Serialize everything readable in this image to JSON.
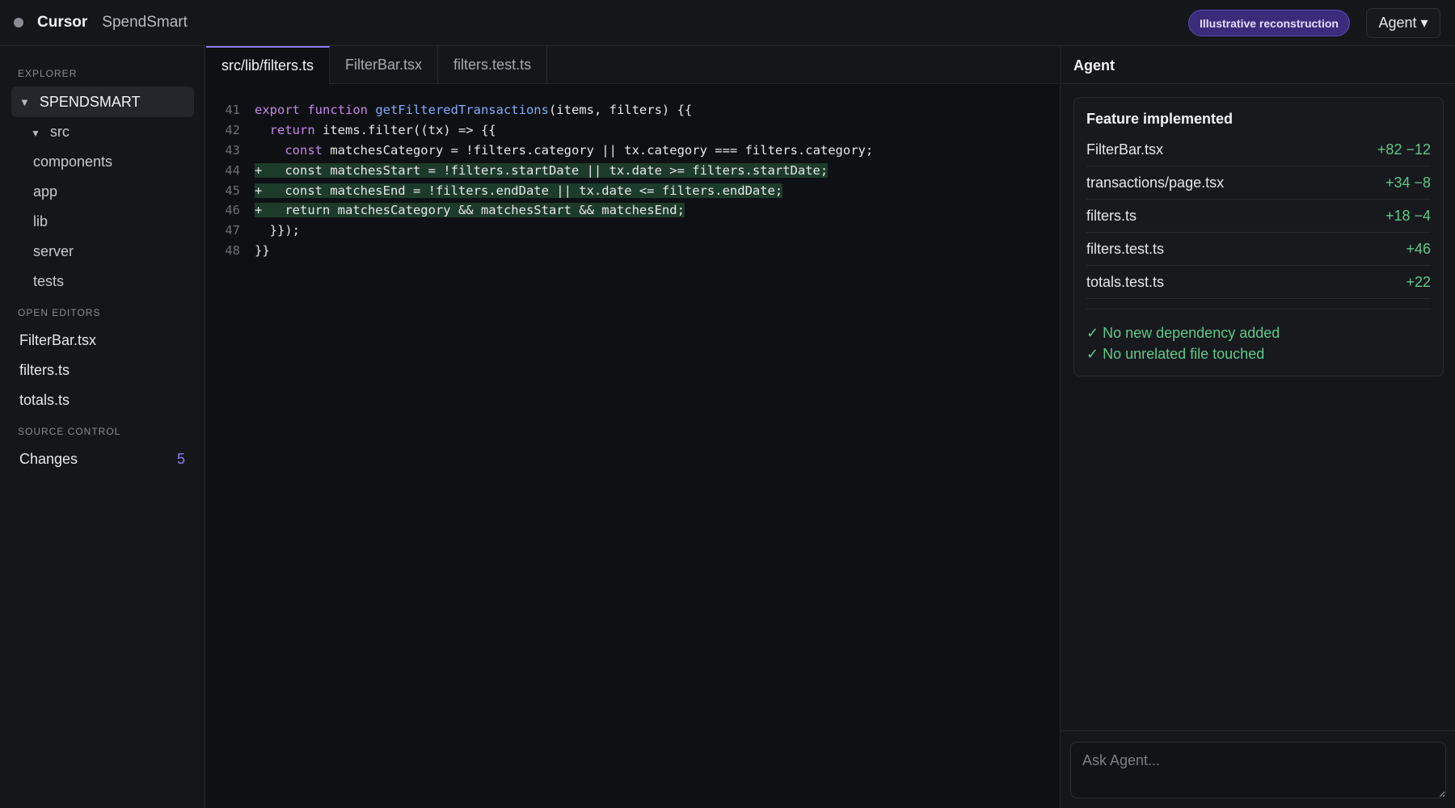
{
  "titlebar": {
    "app_name": "Cursor",
    "project_name": "SpendSmart",
    "badge": "Illustrative reconstruction",
    "agent_dropdown": "Agent ▾"
  },
  "sidebar": {
    "explorer_title": "EXPLORER",
    "root": "SPENDSMART",
    "tree": [
      "src",
      "components",
      "app",
      "lib",
      "server",
      "tests"
    ],
    "open_editors_title": "OPEN EDITORS",
    "open_editors": [
      "FilterBar.tsx",
      "filters.ts",
      "totals.ts"
    ],
    "source_control_title": "SOURCE CONTROL",
    "changes_label": "Changes",
    "changes_count": "5"
  },
  "editor": {
    "tabs": [
      "src/lib/filters.ts",
      "FilterBar.tsx",
      "filters.test.ts"
    ],
    "line_numbers": [
      "41",
      "42",
      "43",
      "44",
      "45",
      "46",
      "47",
      "48"
    ],
    "lines": [
      {
        "kw": "export function ",
        "fn": "getFilteredTransactions",
        "rest": "(items, filters) {{"
      },
      {
        "indent": "  ",
        "kw": "return ",
        "rest": "items.filter((tx) => {{"
      },
      {
        "indent": "    ",
        "kw": "const ",
        "rest": "matchesCategory = !filters.category || tx.category === filters.category;"
      },
      {
        "text": "+   const matchesStart = !filters.startDate || tx.date >= filters.startDate;"
      },
      {
        "text": "+   const matchesEnd = !filters.endDate || tx.date <= filters.endDate;"
      },
      {
        "text": "+   return matchesCategory && matchesStart && matchesEnd;"
      },
      {
        "text": "  }});"
      },
      {
        "text": "}}"
      }
    ]
  },
  "agent": {
    "title": "Agent",
    "card_title": "Feature implemented",
    "files": [
      {
        "name": "FilterBar.tsx",
        "diff": "+82 −12"
      },
      {
        "name": "transactions/page.tsx",
        "diff": "+34 −8"
      },
      {
        "name": "filters.ts",
        "diff": "+18 −4"
      },
      {
        "name": "filters.test.ts",
        "diff": "+46"
      },
      {
        "name": "totals.test.ts",
        "diff": "+22"
      }
    ],
    "checks": [
      "✓ No new dependency added",
      "✓ No unrelated file touched"
    ],
    "ask_placeholder": "Ask Agent..."
  }
}
